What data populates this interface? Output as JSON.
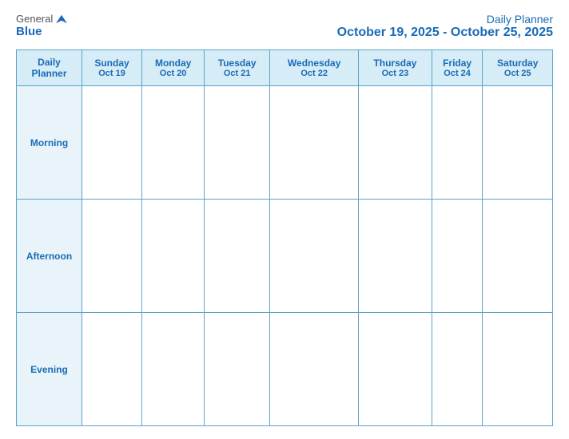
{
  "header": {
    "logo_general": "General",
    "logo_blue": "Blue",
    "title": "Daily Planner",
    "date_range": "October 19, 2025 - October 25, 2025"
  },
  "table": {
    "label_header_line1": "Daily",
    "label_header_line2": "Planner",
    "days": [
      {
        "name": "Sunday",
        "date": "Oct 19"
      },
      {
        "name": "Monday",
        "date": "Oct 20"
      },
      {
        "name": "Tuesday",
        "date": "Oct 21"
      },
      {
        "name": "Wednesday",
        "date": "Oct 22"
      },
      {
        "name": "Thursday",
        "date": "Oct 23"
      },
      {
        "name": "Friday",
        "date": "Oct 24"
      },
      {
        "name": "Saturday",
        "date": "Oct 25"
      }
    ],
    "rows": [
      {
        "label": "Morning"
      },
      {
        "label": "Afternoon"
      },
      {
        "label": "Evening"
      }
    ]
  }
}
